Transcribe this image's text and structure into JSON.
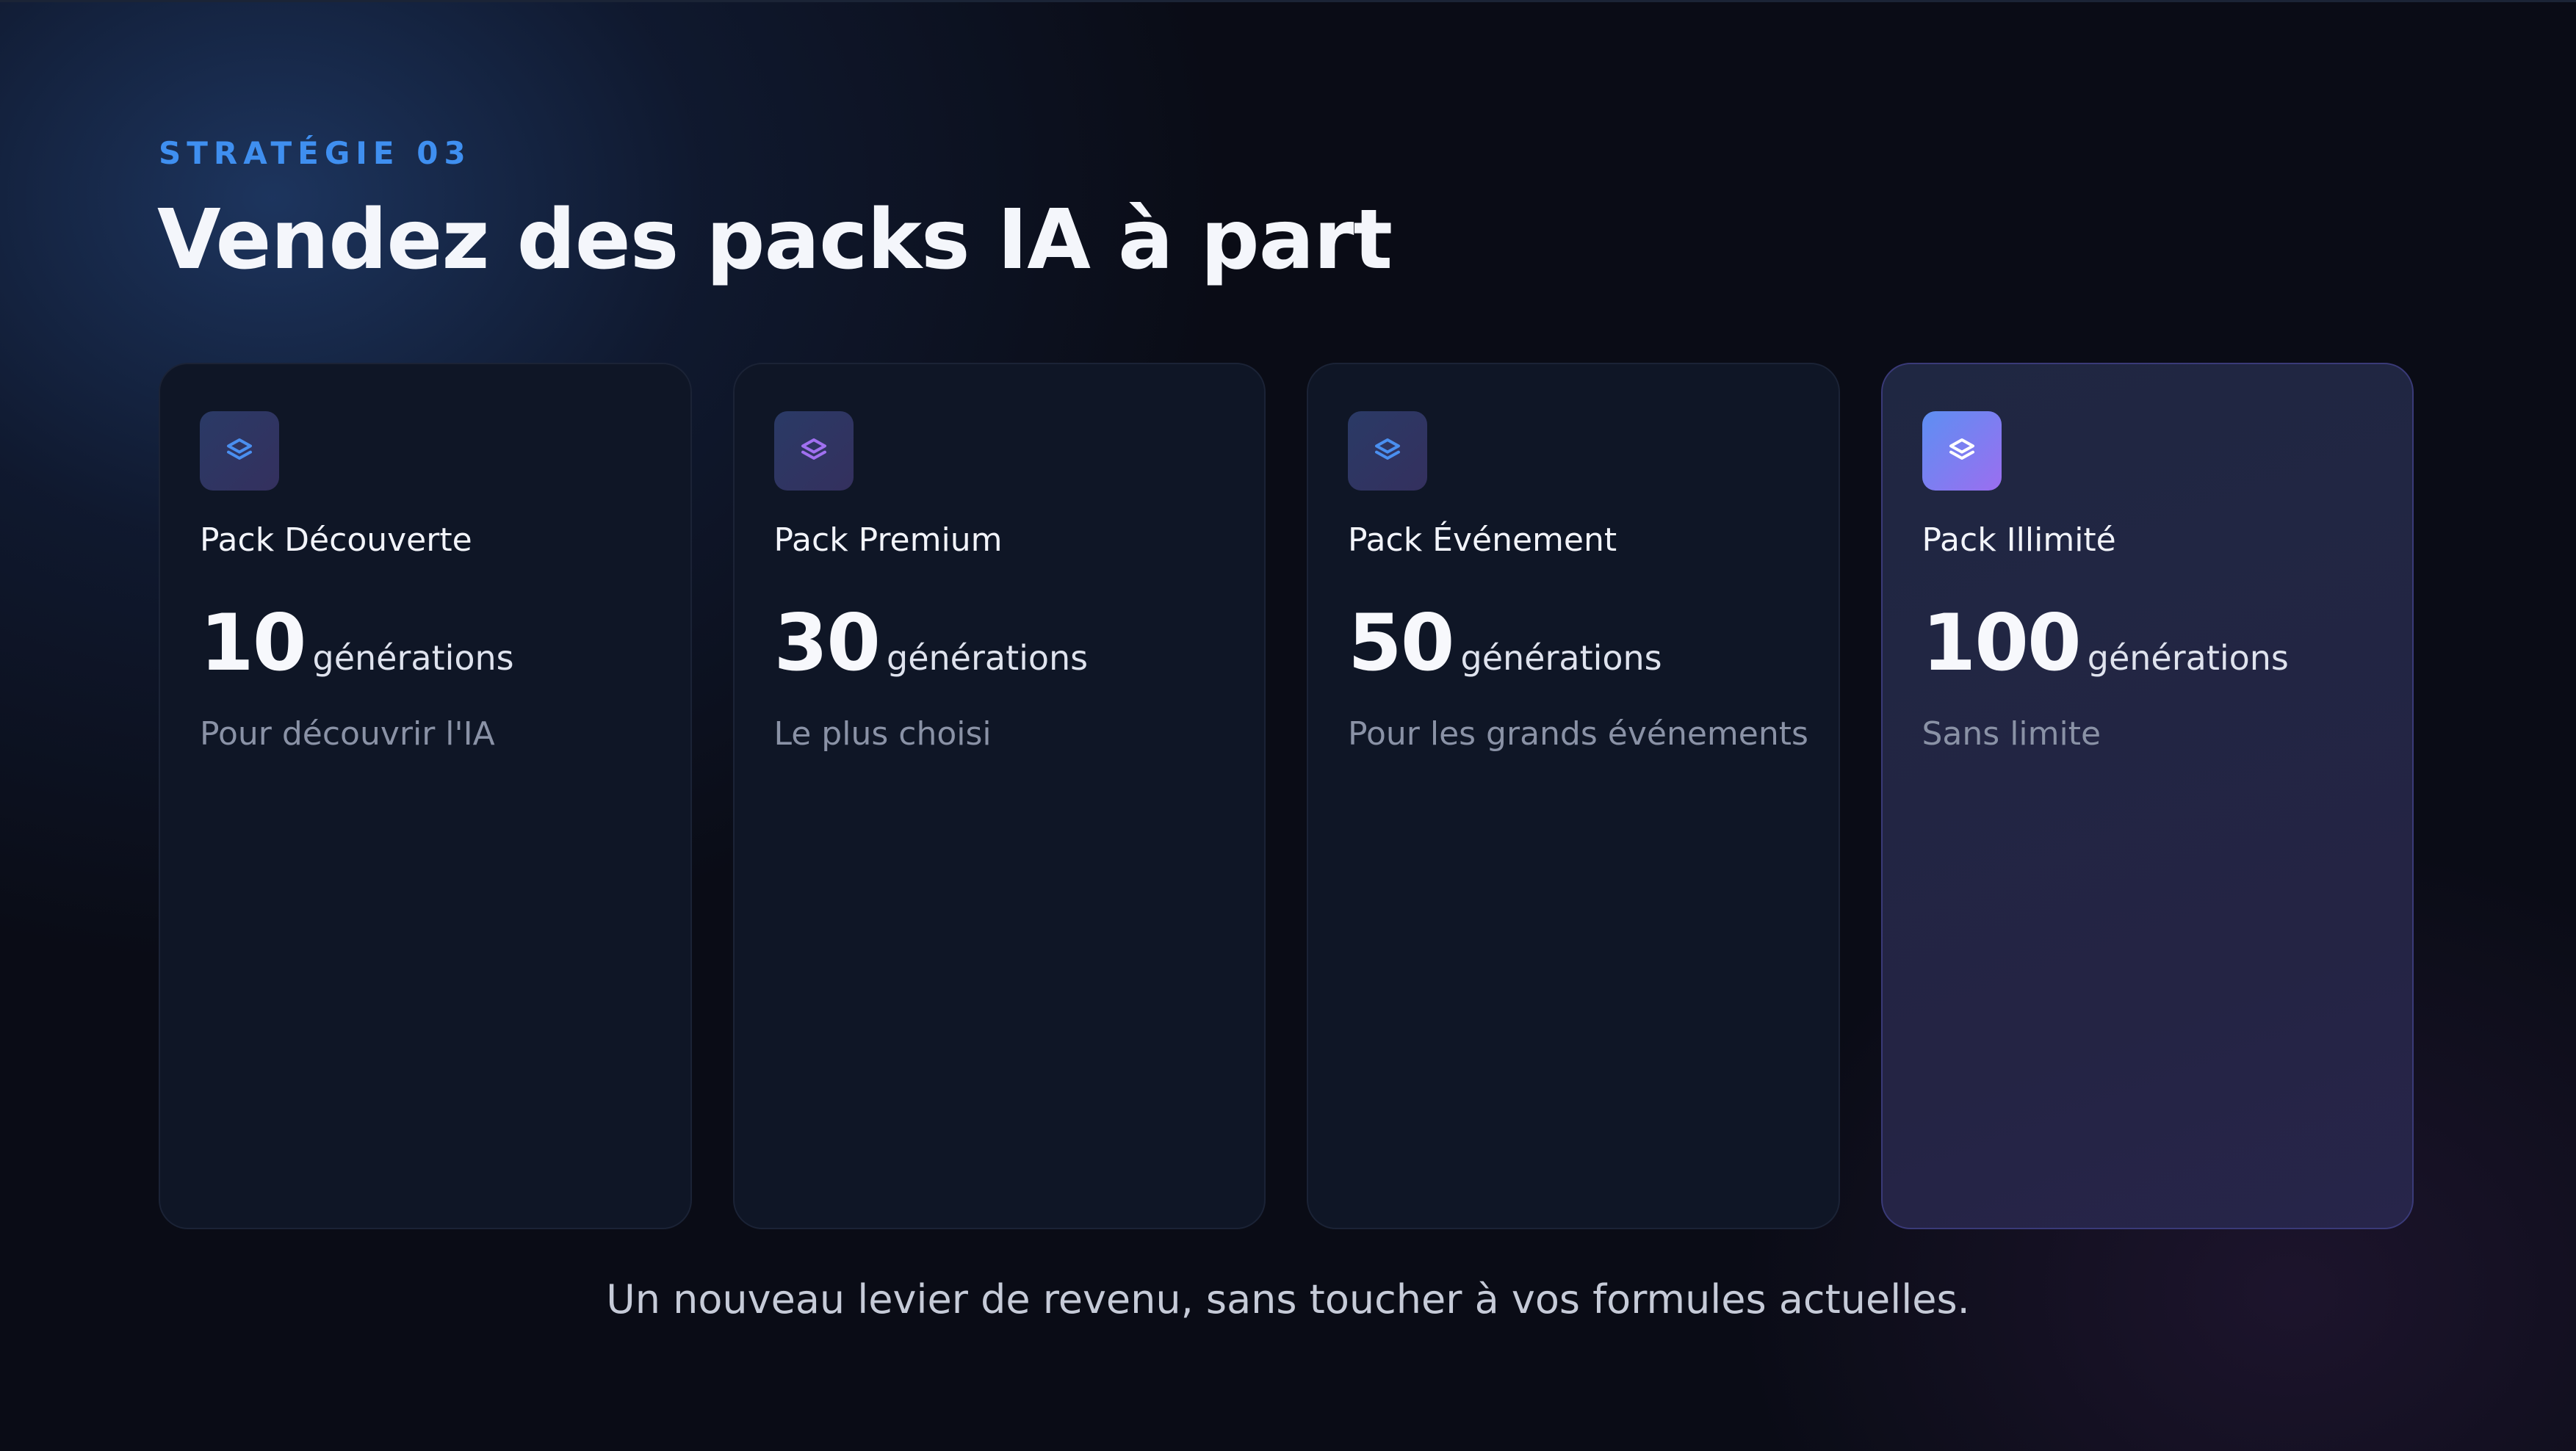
{
  "slide": {
    "eyebrow": "STRATÉGIE 03",
    "title": "Vendez des packs IA à part",
    "footer": "Un nouveau levier de revenu, sans toucher à vos formules actuelles."
  },
  "cards": [
    {
      "name": "Pack Découverte",
      "amount": "10",
      "unit": "générations",
      "subtitle": "Pour découvrir l'IA",
      "icon": "layers-icon",
      "icon_color": "#4a8ff0"
    },
    {
      "name": "Pack Premium",
      "amount": "30",
      "unit": "générations",
      "subtitle": "Le plus choisi",
      "icon": "layers-icon",
      "icon_color": "#a070f0"
    },
    {
      "name": "Pack Événement",
      "amount": "50",
      "unit": "générations",
      "subtitle": "Pour les grands événements",
      "icon": "layers-icon",
      "icon_color": "#4a8ff0"
    },
    {
      "name": "Pack Illimité",
      "amount": "100",
      "unit": "générations",
      "subtitle": "Sans limite",
      "icon": "layers-icon",
      "icon_color": "#ffffff",
      "highlighted": true
    }
  ],
  "colors": {
    "accent": "#3f8ff0",
    "background": "#0a0c16",
    "card": "#0f1626",
    "highlight_card": "#242444"
  }
}
